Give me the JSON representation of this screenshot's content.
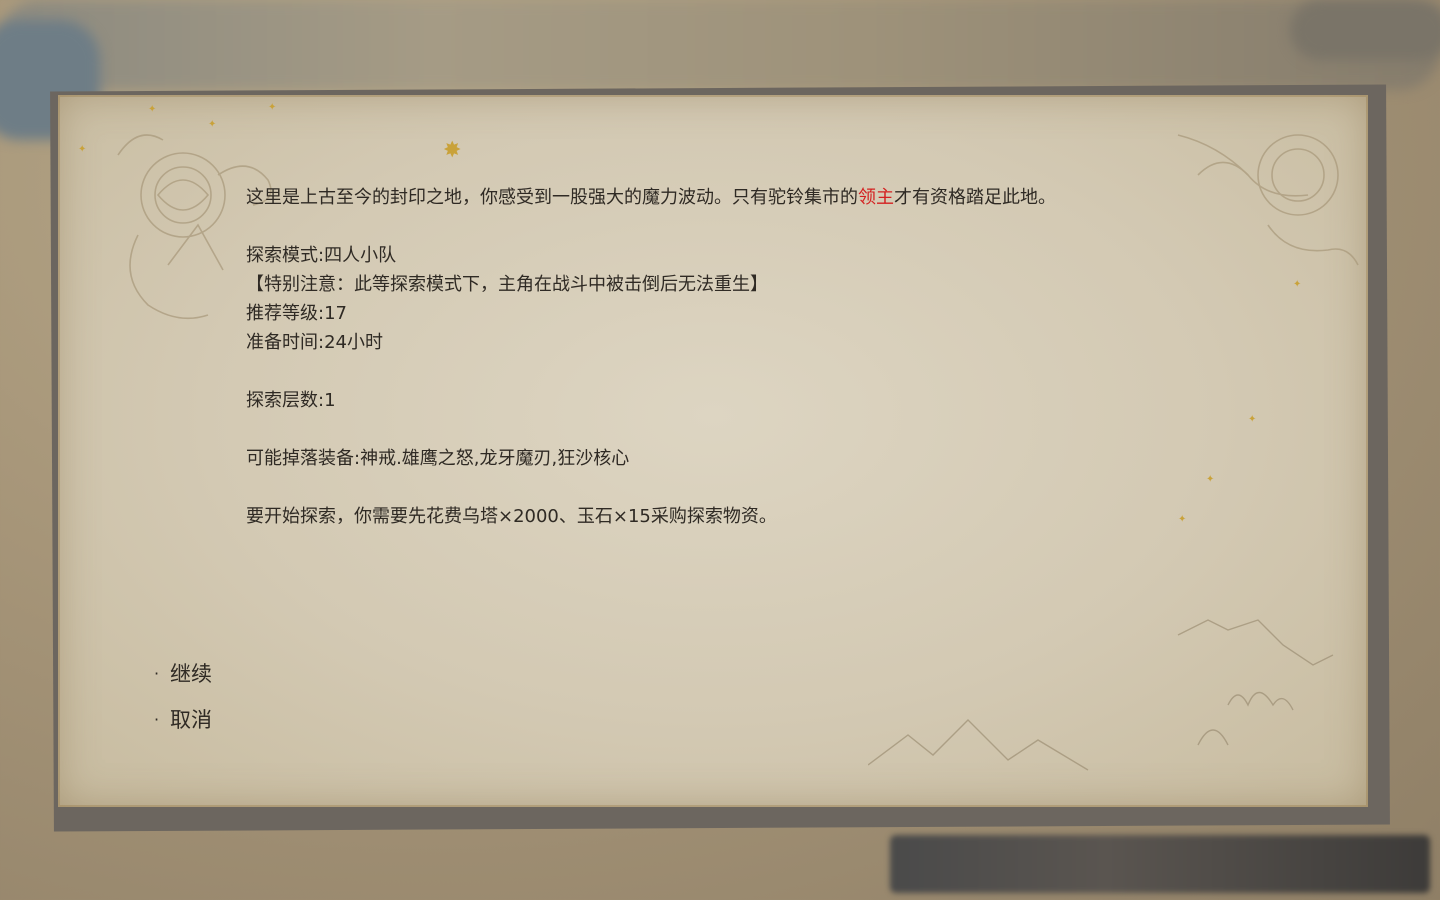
{
  "dialog": {
    "intro_before": "这里是上古至今的封印之地，你感受到一股强大的魔力波动。只有驼铃集市的",
    "intro_highlight": "领主",
    "intro_after": "才有资格踏足此地。",
    "mode": "探索模式:四人小队",
    "notice": "【特别注意：此等探索模式下，主角在战斗中被击倒后无法重生】",
    "level": "推荐等级:17",
    "prep_time": "准备时间:24小时",
    "layers": "探索层数:1",
    "drops": "可能掉落装备:神戒.雄鹰之怒,龙牙魔刃,狂沙核心",
    "cost": "要开始探索，你需要先花费乌塔×2000、玉石×15采购探索物资。"
  },
  "options": [
    {
      "bullet": "·",
      "label": "继续"
    },
    {
      "bullet": "·",
      "label": "取消"
    }
  ],
  "colors": {
    "text": "#2f2a24",
    "highlight": "#d42020",
    "paper": "#d8cfbb",
    "gold": "#c9a23a"
  }
}
